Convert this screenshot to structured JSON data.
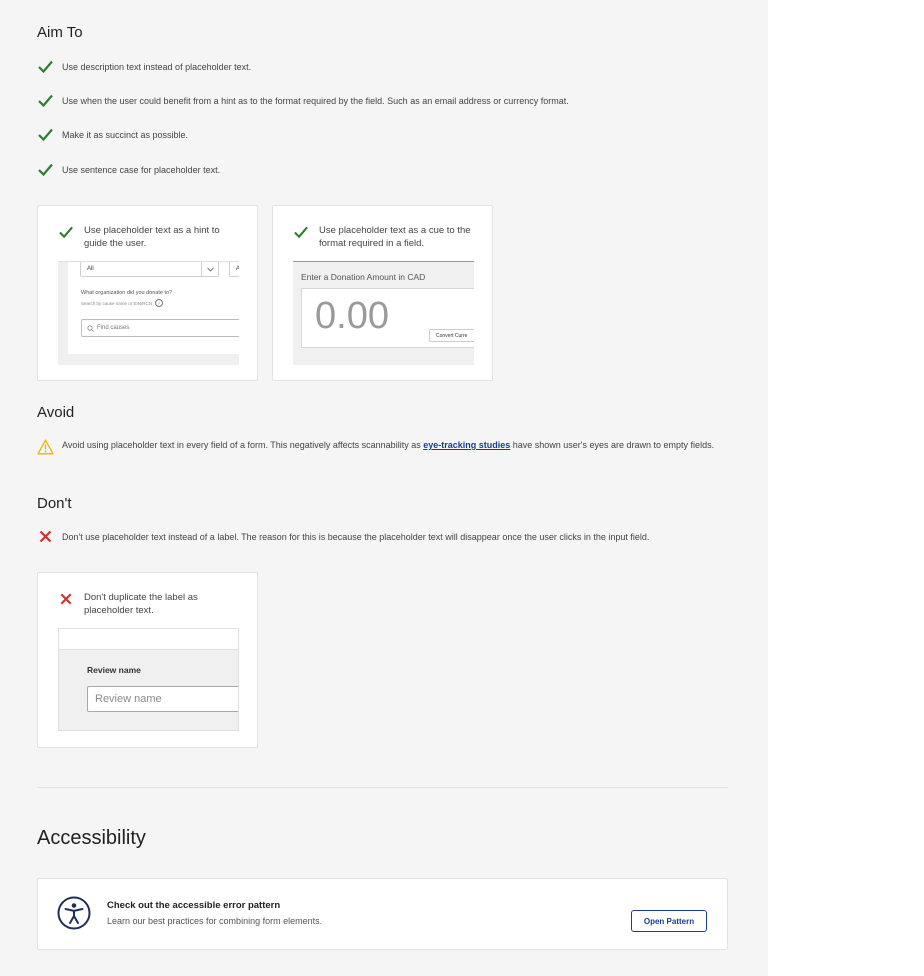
{
  "aim": {
    "heading": "Aim To",
    "items": [
      "Use description text instead of placeholder text.",
      "Use when the user could benefit from a hint as to the format required by the field. Such as an email address or currency format.",
      "Make it as succinct as possible.",
      "Use sentence case for placeholder text."
    ],
    "cards": [
      {
        "text": "Use placeholder text as a hint to guide the user.",
        "example": {
          "select_value": "All",
          "select2_value": "A",
          "question": "What organization did you donate to?",
          "helper": "Search by cause name or EIN/RCN",
          "help_glyph": "?",
          "search_placeholder": "Find causes"
        }
      },
      {
        "text": "Use placeholder text as a cue to the format required in a field.",
        "example": {
          "label": "Enter a Donation Amount in CAD",
          "placeholder": "0.00",
          "convert_label": "Convert Curre"
        }
      }
    ]
  },
  "avoid": {
    "heading": "Avoid",
    "text_before": "Avoid using placeholder text in every field of a form. This negatively affects scannability as ",
    "link": "eye-tracking studies",
    "text_after": " have shown user's eyes are drawn to empty fields."
  },
  "dont": {
    "heading": "Don't",
    "item": "Don't use placeholder text instead of a label. The reason for this is because the placeholder text will disappear once the user clicks in the input field.",
    "card": {
      "text": "Don't duplicate the label as placeholder text.",
      "example": {
        "label": "Review name",
        "placeholder": "Review name"
      }
    }
  },
  "accessibility": {
    "heading": "Accessibility",
    "card_title": "Check out the accessible error pattern",
    "card_desc": "Learn our best practices for combining form elements.",
    "button_label": "Open Pattern"
  },
  "colors": {
    "check": "#2e7d32",
    "cross": "#d32f2f",
    "warning": "#f2b400",
    "link": "#1a3d8f",
    "panel_bg": "#f5f5f5"
  },
  "icons": {
    "do": "check-icon",
    "dont": "cross-icon",
    "avoid": "warning-icon",
    "accessibility": "accessibility-icon"
  }
}
